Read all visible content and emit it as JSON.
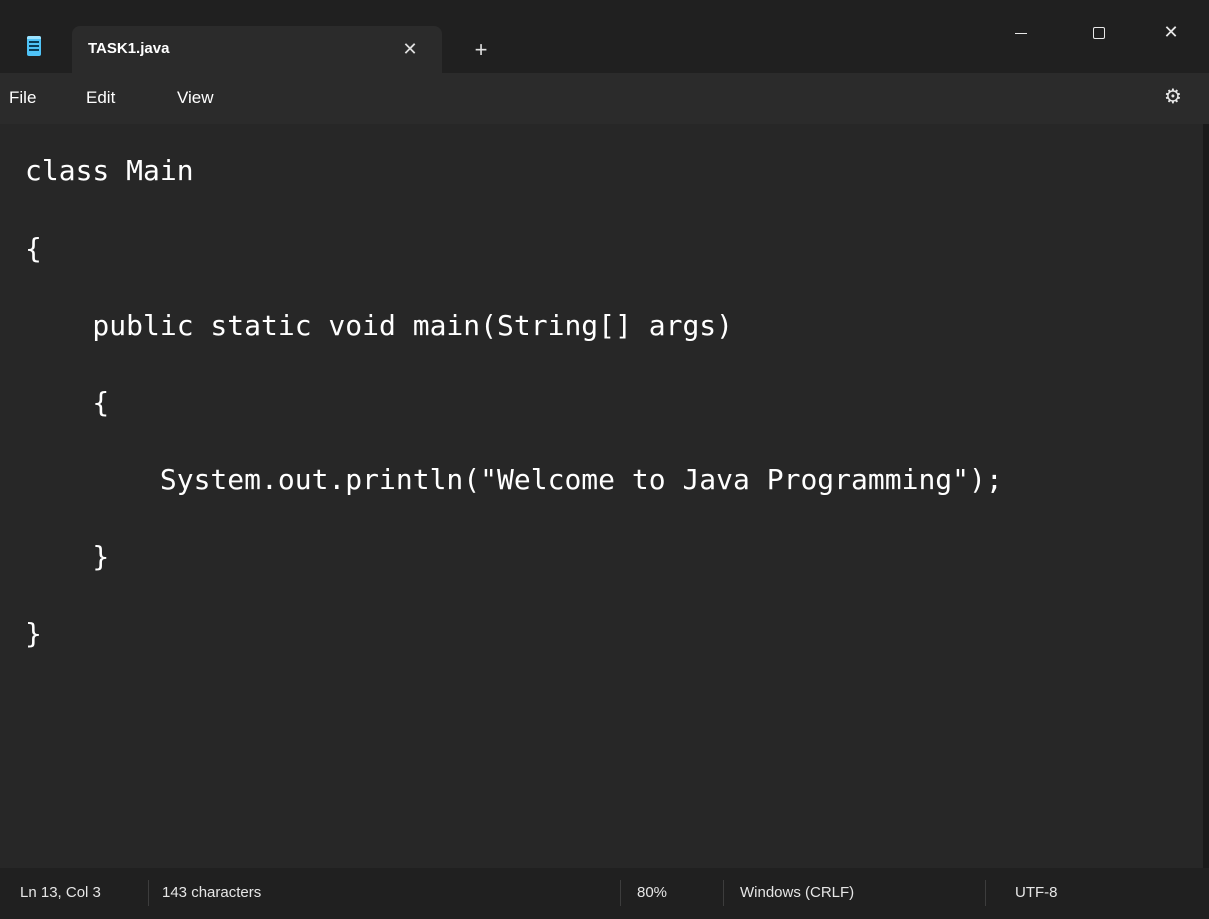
{
  "window": {
    "tab_title": "TASK1.java",
    "tab_close_glyph": "✕",
    "new_tab_glyph": "+",
    "close_glyph": "✕",
    "icons": [
      "notepad-icon",
      "close-icon",
      "plus-icon",
      "minimize-icon",
      "maximize-icon",
      "gear-icon"
    ]
  },
  "menu": {
    "file": "File",
    "edit": "Edit",
    "view": "View",
    "settings_glyph": "⚙"
  },
  "editor": {
    "lines": [
      "class Main",
      "{",
      "    public static void main(String[] args)",
      "    {",
      "        System.out.println(\"Welcome to Java Programming\");",
      "    }",
      "}"
    ]
  },
  "status": {
    "position": "Ln 13, Col 3",
    "characters": "143 characters",
    "zoom": "80%",
    "line_endings": "Windows (CRLF)",
    "encoding": "UTF-8"
  },
  "colors": {
    "titlebar": "#202020",
    "tab": "#2b2b2b",
    "editor_bg": "#272727",
    "text": "#ffffff",
    "app_icon": "#4fc3f7"
  }
}
